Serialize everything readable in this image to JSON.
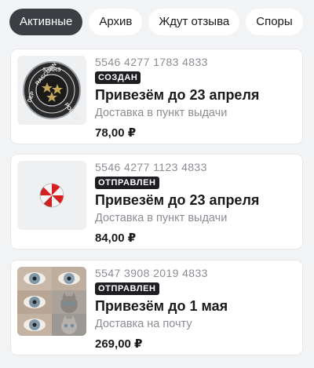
{
  "tabs": [
    {
      "label": "Активные",
      "active": true
    },
    {
      "label": "Архив",
      "active": false
    },
    {
      "label": "Ждут отзыва",
      "active": false
    },
    {
      "label": "Споры",
      "active": false
    }
  ],
  "orders": [
    {
      "number": "5546 4277 1783 4833",
      "status": "СОЗДАН",
      "title": "Привезём до 23 апреля",
      "delivery": "Доставка в пункт выдачи",
      "price": "78,00 ₽",
      "image": "raccoon-police-pin",
      "badge_text": {
        "top": "STARS",
        "left": "RACCOON",
        "bottom": "POLICE",
        "side": "DEP"
      }
    },
    {
      "number": "5546 4277 1123 4833",
      "status": "ОТПРАВЛЕН",
      "title": "Привезём до 23 апреля",
      "delivery": "Доставка в пункт выдачи",
      "price": "84,00 ₽",
      "image": "umbrella-logo-pin"
    },
    {
      "number": "5547 3908 2019 4833",
      "status": "ОТПРАВЛЕН",
      "title": "Привезём до 1 мая",
      "delivery": "Доставка на почту",
      "price": "269,00 ₽",
      "image": "contact-lenses-collage"
    }
  ]
}
